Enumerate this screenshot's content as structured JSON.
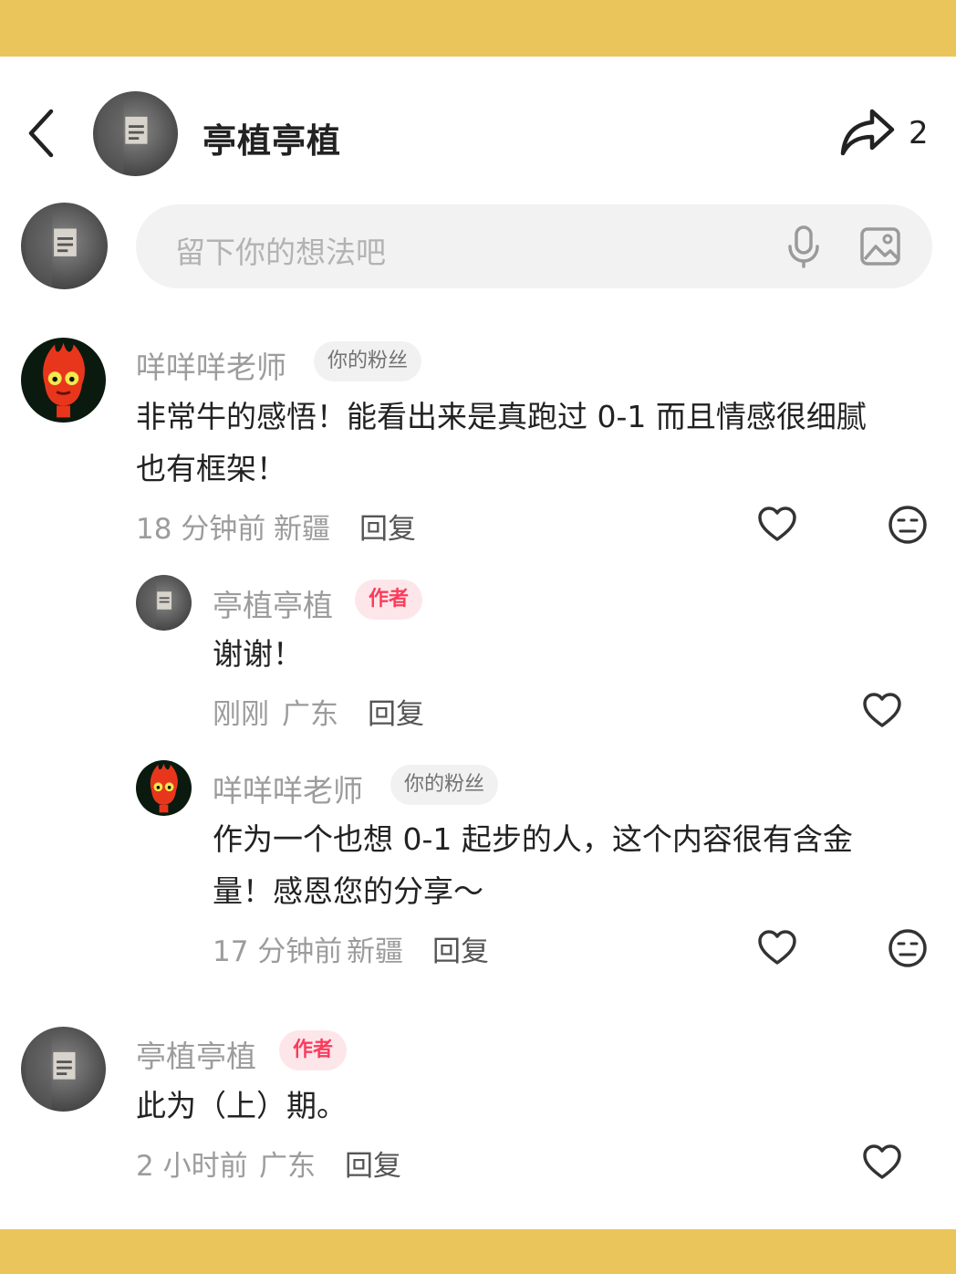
{
  "header": {
    "title": "亭植亭植",
    "share_count": "2"
  },
  "comment_input": {
    "placeholder": "留下你的想法吧"
  },
  "comments": [
    {
      "username": "咩咩咩老师",
      "badge": "你的粉丝",
      "text_line1": "非常牛的感悟！能看出来是真跑过 0-1 而且情感很细腻",
      "text_line2": "也有框架！",
      "time": "18 分钟前",
      "location": "新疆",
      "reply_label": "回复",
      "replies": [
        {
          "username": "亭植亭植",
          "badge": "作者",
          "text_line1": "谢谢！",
          "time": "刚刚",
          "location": "广东",
          "reply_label": "回复"
        },
        {
          "username": "咩咩咩老师",
          "badge": "你的粉丝",
          "text_line1": "作为一个也想 0-1 起步的人，这个内容很有含金",
          "text_line2": "量！感恩您的分享～",
          "time": "17 分钟前",
          "location": "新疆",
          "reply_label": "回复"
        }
      ]
    },
    {
      "username": "亭植亭植",
      "badge": "作者",
      "text_line1": "此为（上）期。",
      "time": "2 小时前",
      "location": "广东",
      "reply_label": "回复"
    }
  ],
  "colors": {
    "band": "#eac55c",
    "author_badge": "#fa3c5c",
    "fan_badge_bg": "#f1f1f1"
  },
  "icons": [
    "back-icon",
    "share-icon",
    "mic-icon",
    "image-icon",
    "heart-icon",
    "dislike-face-icon"
  ]
}
